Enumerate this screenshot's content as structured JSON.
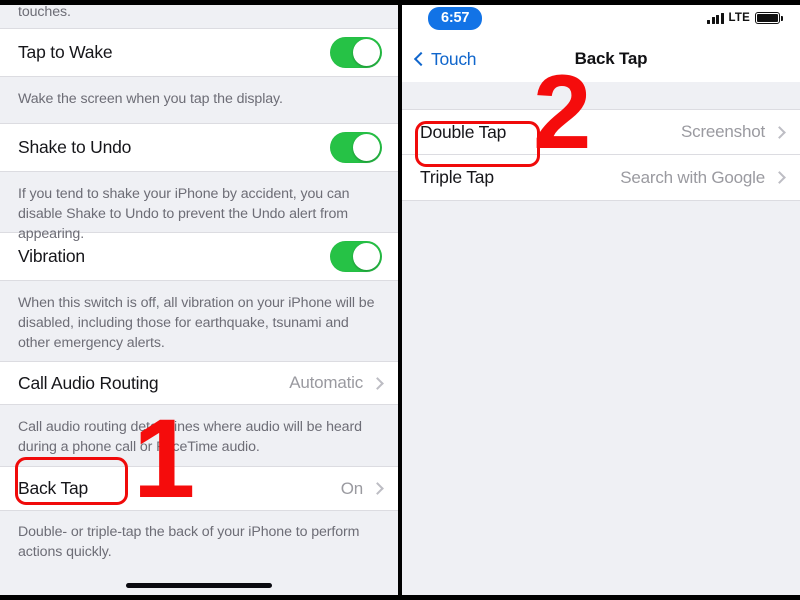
{
  "left_screen": {
    "partial_text_top": "touches.",
    "rows": [
      {
        "label": "Tap to Wake",
        "control": "toggle",
        "toggle_on": true,
        "description": "Wake the screen when you tap the display."
      },
      {
        "label": "Shake to Undo",
        "control": "toggle",
        "toggle_on": true,
        "description": "If you tend to shake your iPhone by accident, you can disable Shake to Undo to prevent the Undo alert from appearing."
      },
      {
        "label": "Vibration",
        "control": "toggle",
        "toggle_on": true,
        "description": "When this switch is off, all vibration on your iPhone will be disabled, including those for earthquake, tsunami and other emergency alerts."
      },
      {
        "label": "Call Audio Routing",
        "control": "disclosure",
        "value": "Automatic",
        "description": "Call audio routing determines where audio will be heard during a phone call or FaceTime audio."
      },
      {
        "label": "Back Tap",
        "control": "disclosure",
        "value": "On",
        "description": "Double- or triple-tap the back of your iPhone to perform actions quickly."
      }
    ]
  },
  "right_screen": {
    "status_bar": {
      "time": "6:57",
      "carrier_tech": "LTE",
      "signal_icon": "signal-bars-icon",
      "battery_icon": "battery-full-icon"
    },
    "nav": {
      "back_label": "Touch",
      "back_icon": "chevron-left-icon",
      "title": "Back Tap"
    },
    "rows": [
      {
        "label": "Double Tap",
        "value": "Screenshot"
      },
      {
        "label": "Triple Tap",
        "value": "Search with Google"
      }
    ]
  },
  "annotations": {
    "step_one": "1",
    "step_two": "2",
    "highlight_color": "#f50c0c"
  }
}
